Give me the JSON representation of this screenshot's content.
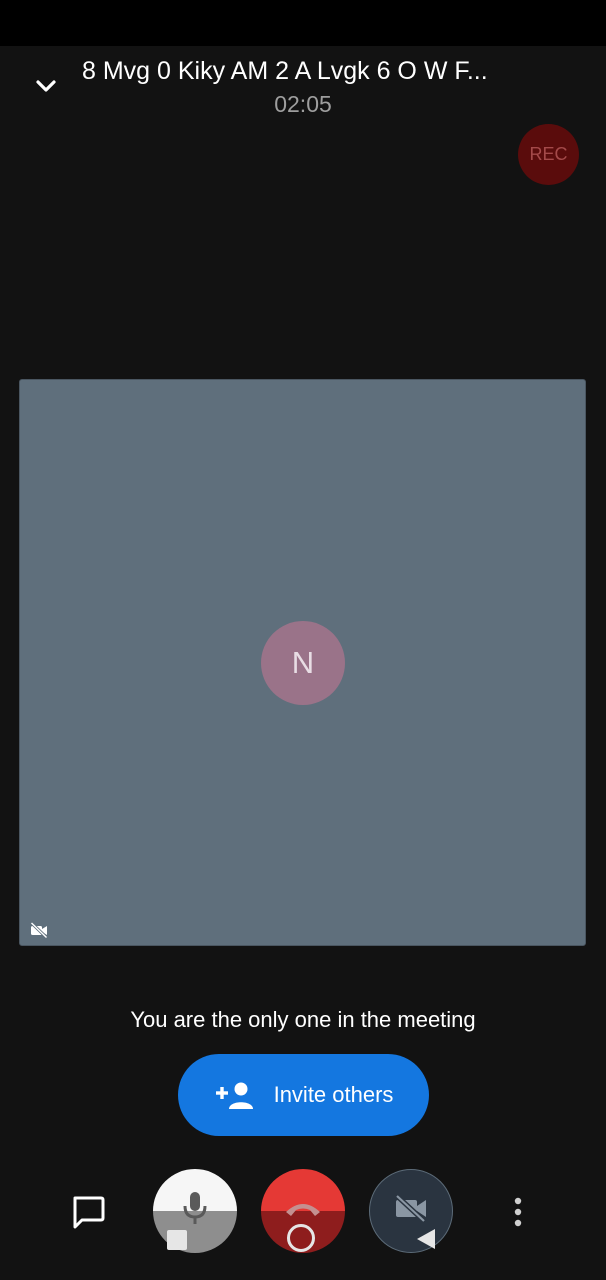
{
  "header": {
    "title": "8 Mvg 0 Kiky AM 2 A Lvgk 6 O W F...",
    "timer": "02:05",
    "collapse_icon": "chevron-down-icon"
  },
  "recording": {
    "label": "REC",
    "color": "#5a0c0c"
  },
  "video_tile": {
    "avatar_initial": "N",
    "avatar_color": "#9a7389",
    "tile_color": "#5f6f7c",
    "camera_status_icon": "video-off-icon"
  },
  "main": {
    "message": "You are the only one in the meeting",
    "invite_button_label": "Invite others",
    "invite_icon": "add-person-icon",
    "accent_color": "#1477e0"
  },
  "controls": {
    "chat_icon": "chat-icon",
    "mic_icon": "microphone-icon",
    "end_call_icon": "hang-up-icon",
    "end_call_color": "#e53935",
    "camera_icon": "video-off-icon",
    "more_icon": "more-vertical-icon"
  },
  "system_nav": {
    "recents_icon": "square-icon",
    "home_icon": "circle-icon",
    "back_icon": "back-triangle-icon"
  }
}
